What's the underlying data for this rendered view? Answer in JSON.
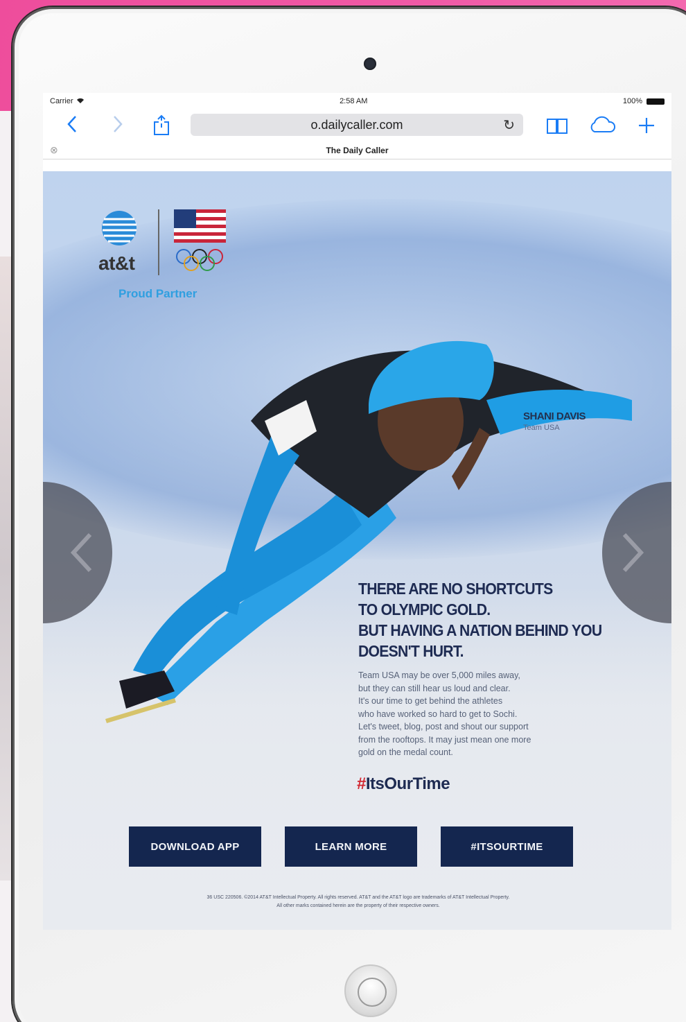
{
  "statusbar": {
    "carrier": "Carrier",
    "time": "2:58 AM",
    "battery_text": "100%"
  },
  "browser": {
    "url": "o.dailycaller.com",
    "tab_title": "The Daily Caller"
  },
  "ad": {
    "brand": "at&t",
    "partner_text": "Proud Partner",
    "athlete_name": "SHANI DAVIS",
    "athlete_team": "Team USA",
    "headline": [
      "THERE ARE NO SHORTCUTS",
      "TO OLYMPIC GOLD.",
      "BUT HAVING A NATION BEHIND YOU",
      "DOESN'T HURT."
    ],
    "body": [
      "Team USA may be over 5,000 miles away,",
      "but they can still hear us loud and clear.",
      "It's our time to get behind the athletes",
      "who have worked so hard to get to Sochi.",
      "Let's tweet, blog, post and shout our support",
      "from the rooftops. It may just mean one more",
      "gold on the medal count."
    ],
    "hashtag_symbol": "#",
    "hashtag_text": "ItsOurTime",
    "buttons": {
      "download": "DOWNLOAD APP",
      "learn": "LEARN MORE",
      "hashtag": "#ITSOURTIME"
    },
    "legal": [
      "36 USC 220506. ©2014 AT&T Intellectual Property. All rights reserved. AT&T and the AT&T logo are trademarks of AT&T Intellectual Property.",
      "All other marks contained herein are the property of their respective owners."
    ]
  },
  "colors": {
    "navy": "#14264f",
    "accent_blue": "#2f9fe0",
    "ios_blue": "#1a7cf5",
    "hashtag_red": "#d2262f"
  }
}
